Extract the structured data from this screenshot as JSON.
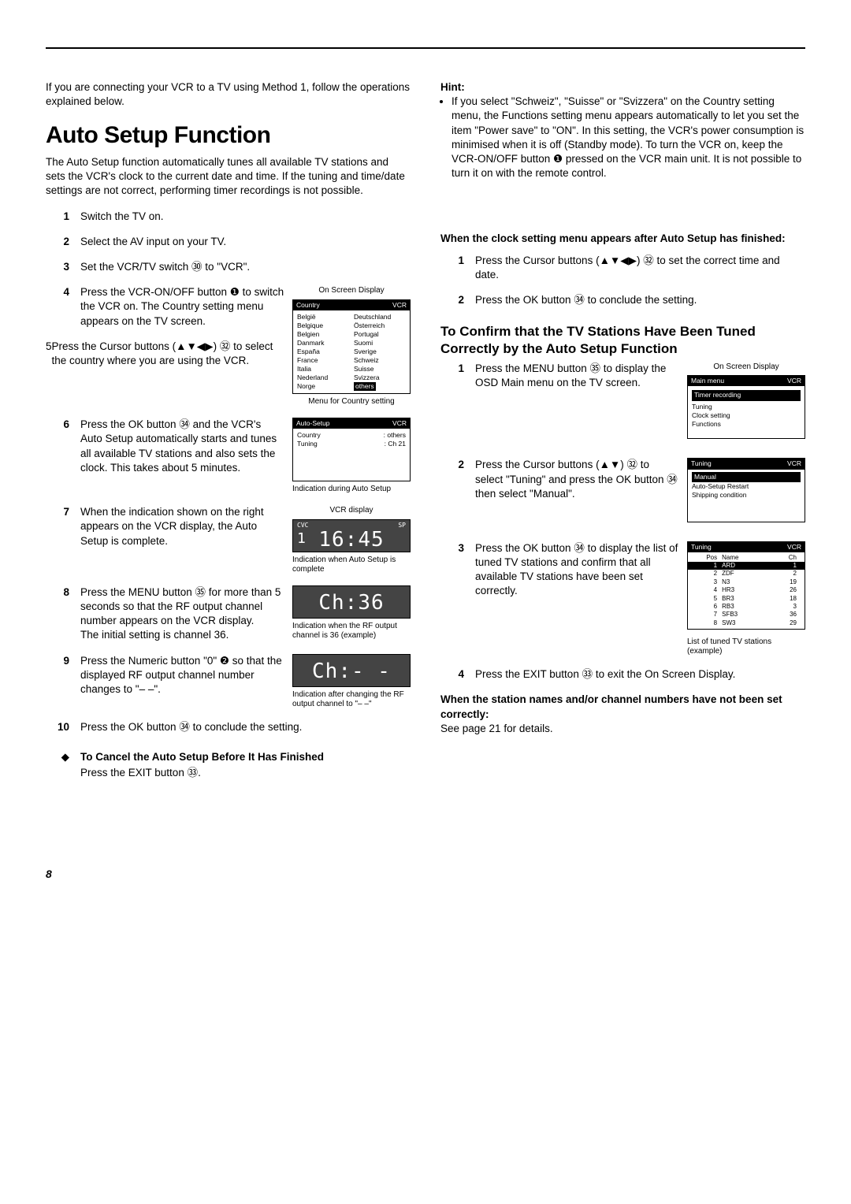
{
  "page_number": "8",
  "intro": "If you are connecting your VCR to a TV using Method 1, follow the operations explained below.",
  "title": "Auto Setup Function",
  "desc": "The Auto Setup function automatically tunes all available TV stations and sets the VCR's clock to the current date and time. If the tuning and time/date settings are not correct, performing timer recordings is not possible.",
  "steps": [
    {
      "n": "1",
      "text": "Switch the TV on."
    },
    {
      "n": "2",
      "text": "Select the AV input on your TV."
    },
    {
      "n": "3",
      "text": "Set the VCR/TV switch ㉚ to \"VCR\"."
    },
    {
      "n": "4",
      "text": "Press the VCR-ON/OFF button ❶ to switch the VCR on. The Country setting menu appears on the TV screen."
    },
    {
      "n": "5",
      "text": "Press the Cursor buttons (▲▼◀▶) ㉜ to select  the country where you are using the VCR."
    },
    {
      "n": "6",
      "text": "Press the OK button ㉞ and the VCR's Auto Setup automatically starts and tunes all available TV stations and also sets the clock. This takes about 5 minutes."
    },
    {
      "n": "7",
      "text": "When the indication shown on the right appears on the VCR display, the Auto Setup is complete."
    },
    {
      "n": "8",
      "text": "Press the MENU button ㉟ for more than 5 seconds so that the RF output channel number appears on the VCR display.",
      "extra": "The initial setting is channel 36."
    },
    {
      "n": "9",
      "text": "Press the Numeric button \"0\" ❷ so that the displayed RF output channel number changes to \"– –\"."
    },
    {
      "n": "10",
      "text": "Press the OK button ㉞ to conclude the setting."
    }
  ],
  "cancel_heading": "To Cancel the Auto Setup Before It Has Finished",
  "cancel_text": "Press the EXIT button ㉝.",
  "osd_label_top": "On Screen Display",
  "osd1": {
    "title": "Country",
    "vcr": "VCR",
    "left": [
      "België",
      "Belgique",
      "Belgien",
      "Danmark",
      "España",
      "France",
      "Italia",
      "Nederland",
      "Norge"
    ],
    "right": [
      "Deutschland",
      "Österreich",
      "Portugal",
      "Suomi",
      "Sverige",
      "Schweiz",
      "Suisse",
      "Svizzera",
      "others"
    ],
    "caption": "Menu for Country setting"
  },
  "osd2": {
    "title": "Auto-Setup",
    "vcr": "VCR",
    "rows": [
      [
        "Country",
        ": others"
      ],
      [
        "Tuning",
        ": Ch  21"
      ]
    ],
    "caption": "Indication during Auto Setup"
  },
  "lcd1": {
    "label": "VCR display",
    "cvc": "CVC",
    "sp": "SP",
    "left": "1",
    "big": "16:45",
    "caption": "Indication when Auto Setup is complete"
  },
  "lcd2": {
    "big": "Ch:36",
    "caption": "Indication when the RF output channel is 36 (example)"
  },
  "lcd3": {
    "big": "Ch:- -",
    "caption": "Indication after changing the RF output channel to   \"– –\""
  },
  "hint_label": "Hint:",
  "hint": "If you select \"Schweiz\", \"Suisse\" or \"Svizzera\" on the Country setting menu, the Functions setting menu appears automatically to let you set the item \"Power save\" to \"ON\". In this setting, the VCR's power consumption is minimised when it is off (Standby mode). To turn the VCR on, keep the VCR-ON/OFF button ❶ pressed on the VCR main unit. It is not possible to turn it on with the remote control.",
  "clock_heading": "When the clock setting menu appears after Auto Setup has finished:",
  "clock_steps": [
    {
      "n": "1",
      "text": "Press the Cursor buttons (▲▼◀▶) ㉜ to set the correct time and date."
    },
    {
      "n": "2",
      "text": "Press the OK button ㉞ to conclude the setting."
    }
  ],
  "confirm_heading": "To Confirm that the TV Stations Have Been Tuned Correctly by the Auto Setup Function",
  "confirm_steps": [
    {
      "n": "1",
      "text": "Press the MENU button ㉟ to display the OSD Main menu on the TV screen."
    },
    {
      "n": "2",
      "text": "Press the Cursor buttons (▲▼) ㉜ to select \"Tuning\" and press the OK button ㉞ then select \"Manual\"."
    },
    {
      "n": "3",
      "text": "Press the OK button ㉞ to display the list of tuned TV stations and confirm that all available TV stations have been set correctly."
    },
    {
      "n": "4",
      "text": "Press the EXIT button ㉝ to exit the On Screen Display."
    }
  ],
  "osd_main": {
    "title": "Main menu",
    "vcr": "VCR",
    "items": [
      "Timer recording",
      "Tuning",
      "Clock setting",
      "Functions"
    ]
  },
  "osd_tuning": {
    "title": "Tuning",
    "vcr": "VCR",
    "items": [
      "Manual",
      "Auto-Setup Restart",
      "Shipping condition"
    ]
  },
  "osd_list": {
    "title": "Tuning",
    "vcr": "VCR",
    "head": [
      "Pos",
      "Name",
      "Ch"
    ],
    "rows": [
      [
        "1",
        "ARD",
        "1"
      ],
      [
        "2",
        "ZDF",
        "2"
      ],
      [
        "3",
        "N3",
        "19"
      ],
      [
        "4",
        "HR3",
        "26"
      ],
      [
        "5",
        "BR3",
        "18"
      ],
      [
        "6",
        "RB3",
        "3"
      ],
      [
        "7",
        "SFB3",
        "36"
      ],
      [
        "8",
        "SW3",
        "29"
      ]
    ],
    "caption": "List of tuned TV stations (example)"
  },
  "not_correct_heading": "When the station names and/or channel numbers have not been set correctly:",
  "not_correct_text": "See page 21 for details."
}
